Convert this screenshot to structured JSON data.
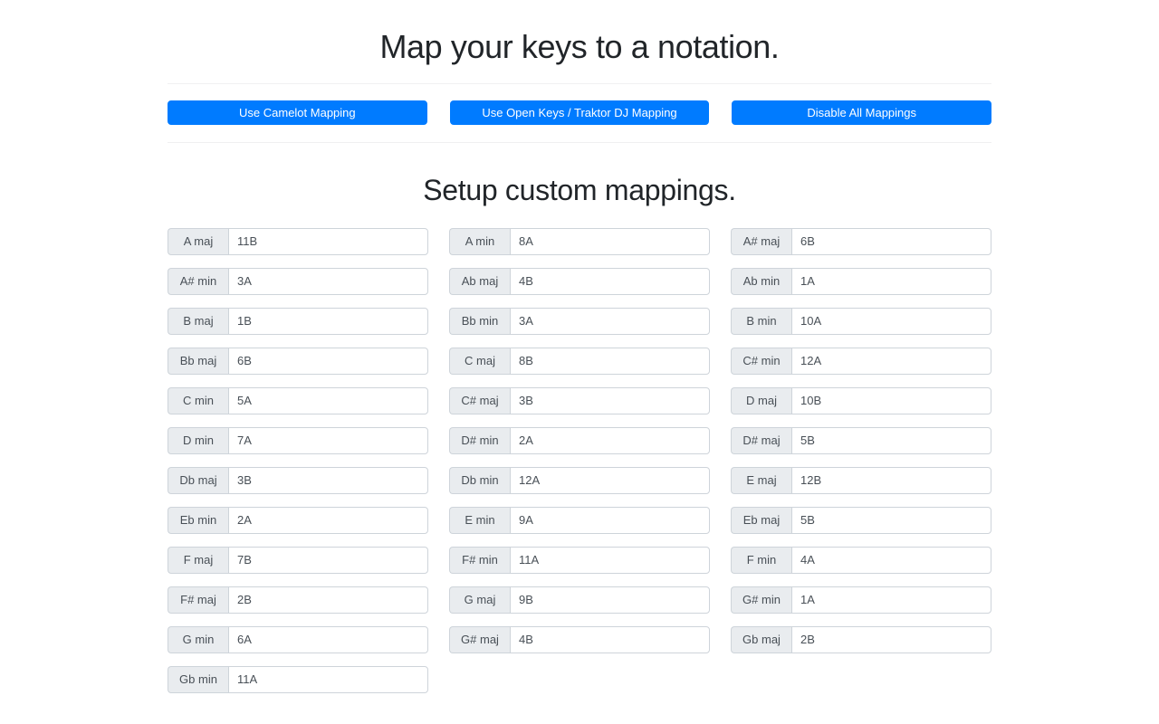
{
  "header": {
    "title": "Map your keys to a notation."
  },
  "actions": {
    "buttons": [
      {
        "label": "Use Camelot Mapping",
        "name": "use-camelot-mapping-button",
        "color": "#007bff"
      },
      {
        "label": "Use Open Keys / Traktor DJ Mapping",
        "name": "use-open-keys-traktor-dj-mapping-button",
        "color": "#007bff"
      },
      {
        "label": "Disable All Mappings",
        "name": "disable-all-mappings-button",
        "color": "#007bff"
      }
    ]
  },
  "section": {
    "title": "Setup custom mappings."
  },
  "mappings": {
    "placeholder": "",
    "columns": [
      {
        "rows": [
          {
            "key": "A maj",
            "value": "11B"
          },
          {
            "key": "A# min",
            "value": "3A"
          },
          {
            "key": "B maj",
            "value": "1B"
          },
          {
            "key": "Bb maj",
            "value": "6B"
          },
          {
            "key": "C min",
            "value": "5A"
          },
          {
            "key": "D min",
            "value": "7A"
          },
          {
            "key": "Db maj",
            "value": "3B"
          },
          {
            "key": "Eb min",
            "value": "2A"
          },
          {
            "key": "F maj",
            "value": "7B"
          },
          {
            "key": "F# maj",
            "value": "2B"
          },
          {
            "key": "G min",
            "value": "6A"
          },
          {
            "key": "Gb min",
            "value": "11A"
          }
        ]
      },
      {
        "rows": [
          {
            "key": "A min",
            "value": "8A"
          },
          {
            "key": "Ab maj",
            "value": "4B"
          },
          {
            "key": "Bb min",
            "value": "3A"
          },
          {
            "key": "C maj",
            "value": "8B"
          },
          {
            "key": "C# maj",
            "value": "3B"
          },
          {
            "key": "D# min",
            "value": "2A"
          },
          {
            "key": "Db min",
            "value": "12A"
          },
          {
            "key": "E min",
            "value": "9A"
          },
          {
            "key": "F# min",
            "value": "11A"
          },
          {
            "key": "G maj",
            "value": "9B"
          },
          {
            "key": "G# maj",
            "value": "4B"
          }
        ]
      },
      {
        "rows": [
          {
            "key": "A# maj",
            "value": "6B"
          },
          {
            "key": "Ab min",
            "value": "1A"
          },
          {
            "key": "B min",
            "value": "10A"
          },
          {
            "key": "C# min",
            "value": "12A"
          },
          {
            "key": "D maj",
            "value": "10B"
          },
          {
            "key": "D# maj",
            "value": "5B"
          },
          {
            "key": "E maj",
            "value": "12B"
          },
          {
            "key": "Eb maj",
            "value": "5B"
          },
          {
            "key": "F min",
            "value": "4A"
          },
          {
            "key": "G# min",
            "value": "1A"
          },
          {
            "key": "Gb maj",
            "value": "2B"
          }
        ]
      }
    ]
  },
  "theme": {
    "primary": "#007bff",
    "label_bg": "#e9ecef",
    "border": "#ced4da",
    "text": "#212529",
    "divider": "#f0f0f1"
  }
}
